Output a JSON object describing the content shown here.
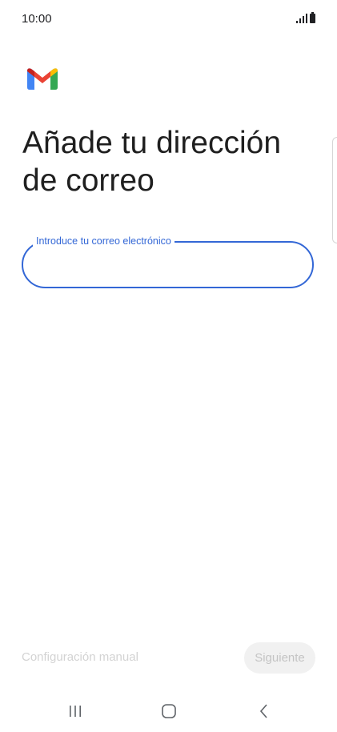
{
  "status_bar": {
    "time": "10:00",
    "icons": [
      "signal-icon",
      "battery-icon"
    ]
  },
  "app": {
    "logo": "gmail-logo"
  },
  "page": {
    "heading": "Añade tu dirección de correo"
  },
  "email_field": {
    "label": "Introduce tu correo electrónico",
    "value": "",
    "placeholder": ""
  },
  "footer": {
    "manual_config_label": "Configuración manual",
    "next_label": "Siguiente"
  },
  "nav_bar": {
    "buttons": [
      "recents-icon",
      "home-icon",
      "back-icon"
    ]
  },
  "colors": {
    "accent": "#3367d6",
    "text": "#1f1f1f",
    "disabled_text": "#c4c4c4",
    "disabled_bg": "#f1f1f1",
    "gmail_red": "#ea4335",
    "gmail_blue": "#4285f4",
    "gmail_green": "#34a853",
    "gmail_yellow": "#fbbc04"
  }
}
